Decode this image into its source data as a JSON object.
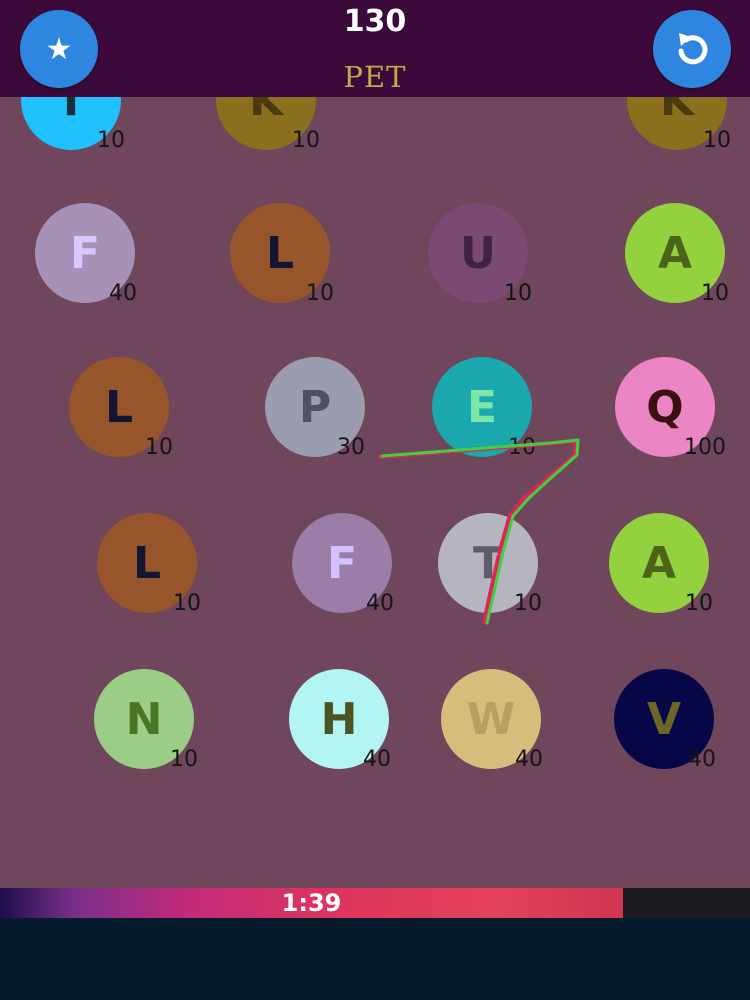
{
  "header": {
    "score": "130",
    "current_word": "PET",
    "star_button_icon": "star-icon",
    "restart_button_icon": "restart-icon"
  },
  "tiles": [
    {
      "letter": "T",
      "points": "10",
      "color": "#1fc1ff",
      "text_color": "#12323a"
    },
    {
      "letter": "K",
      "points": "10",
      "color": "#8a6f1c",
      "text_color": "#4a3a10"
    },
    {
      "letter": "K",
      "points": "10",
      "color": "#8a6f1c",
      "text_color": "#4a3a10"
    },
    {
      "letter": "F",
      "points": "40",
      "color": "#a891b7",
      "text_color": "#d9c7ff"
    },
    {
      "letter": "L",
      "points": "10",
      "color": "#96552b",
      "text_color": "#141533"
    },
    {
      "letter": "U",
      "points": "10",
      "color": "#7b4a72",
      "text_color": "#3f2246"
    },
    {
      "letter": "A",
      "points": "10",
      "color": "#93d13e",
      "text_color": "#4c6419"
    },
    {
      "letter": "L",
      "points": "10",
      "color": "#96552b",
      "text_color": "#141533"
    },
    {
      "letter": "P",
      "points": "30",
      "color": "#9b9daf",
      "text_color": "#4e5160"
    },
    {
      "letter": "E",
      "points": "10",
      "color": "#1aa7ad",
      "text_color": "#7ee6a6"
    },
    {
      "letter": "Q",
      "points": "100",
      "color": "#ec85c3",
      "text_color": "#3a1010"
    },
    {
      "letter": "L",
      "points": "10",
      "color": "#96552b",
      "text_color": "#141533"
    },
    {
      "letter": "F",
      "points": "40",
      "color": "#9a7ea7",
      "text_color": "#d4c1ff"
    },
    {
      "letter": "T",
      "points": "10",
      "color": "#b5b5c0",
      "text_color": "#5d5d69"
    },
    {
      "letter": "A",
      "points": "10",
      "color": "#93d13e",
      "text_color": "#4c6419"
    },
    {
      "letter": "N",
      "points": "10",
      "color": "#9ccd86",
      "text_color": "#4b7522"
    },
    {
      "letter": "H",
      "points": "40",
      "color": "#b3f5f2",
      "text_color": "#4d5423"
    },
    {
      "letter": "W",
      "points": "40",
      "color": "#d4be7c",
      "text_color": "#b7a162"
    },
    {
      "letter": "V",
      "points": "40",
      "color": "#070647",
      "text_color": "#6e6626"
    }
  ],
  "timer": {
    "label": "1:39",
    "progress_percent": 83
  },
  "colors": {
    "background": "#70465c",
    "header": "#3c0a3a",
    "button": "#2f86e0",
    "stroke_green": "#3fd23f",
    "stroke_red": "#e0245a"
  }
}
